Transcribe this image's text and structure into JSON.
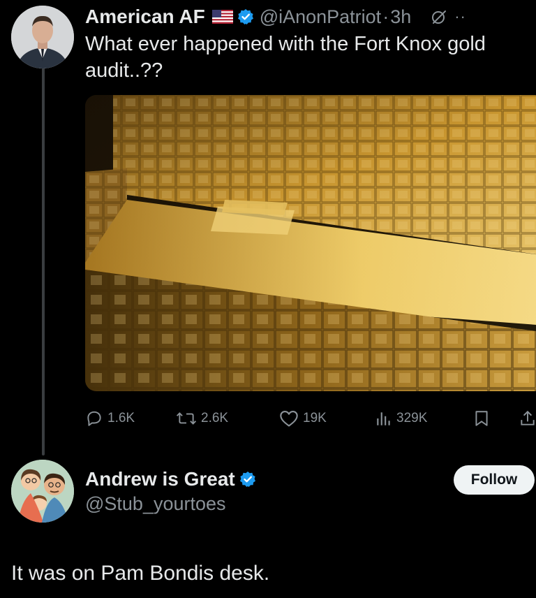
{
  "tweet": {
    "author_name": "American AF",
    "flag_icon": "us-flag-icon",
    "verified_icon": "verified-badge-icon",
    "handle": "@iAnonPatriot",
    "separator": "·",
    "time": "3h",
    "grok_icon": "grok-icon",
    "more_icon": "more-icon",
    "more_label": "··",
    "text": "What ever happened with the Fort Knox gold audit..??",
    "media_alt_icon": "gold-bars-photo",
    "actions": {
      "replies": "1.6K",
      "retweets": "2.6K",
      "likes": "19K",
      "views": "329K"
    }
  },
  "reply": {
    "author_name": "Andrew is Great",
    "verified_icon": "verified-badge-icon",
    "handle": "@Stub_yourtoes",
    "follow_label": "Follow",
    "text": "It was on Pam Bondis desk."
  },
  "colors": {
    "background": "#000000",
    "text": "#e7e9ea",
    "secondary": "#8b9298",
    "verified": "#1d9bf0",
    "thread_line": "#3a3d40",
    "follow_bg": "#eff3f4"
  }
}
